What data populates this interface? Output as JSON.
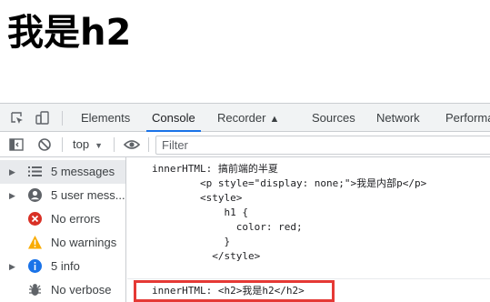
{
  "page": {
    "heading": "我是h2"
  },
  "devtools": {
    "tabs": [
      {
        "label": "Elements"
      },
      {
        "label": "Console"
      },
      {
        "label": "Recorder"
      },
      {
        "label": "Sources"
      },
      {
        "label": "Network"
      },
      {
        "label": "Performa"
      }
    ],
    "active_tab": "Console",
    "recorder_icon": "flask-icon",
    "toolbar": {
      "context": "top",
      "filter_placeholder": "Filter",
      "filter_value": ""
    },
    "sidebar": {
      "items": [
        {
          "label": "5 messages",
          "icon": "list-icon",
          "expandable": true,
          "selected": true
        },
        {
          "label": "5 user mess...",
          "icon": "user-icon",
          "expandable": true
        },
        {
          "label": "No errors",
          "icon": "error-icon",
          "expandable": false
        },
        {
          "label": "No warnings",
          "icon": "warning-icon",
          "expandable": false
        },
        {
          "label": "5 info",
          "icon": "info-icon",
          "expandable": true
        },
        {
          "label": "No verbose",
          "icon": "bug-icon",
          "expandable": false
        }
      ]
    },
    "console": {
      "messages": [
        {
          "text": "innerHTML: 搞前端的半夏\n        <p style=\"display: none;\">我是内部p</p>\n        <style>\n            h1 {\n              color: red;\n            }\n          </style>"
        },
        {
          "text": "innerHTML: <h2>我是h2</h2>"
        }
      ]
    },
    "colors": {
      "accent": "#1a73e8",
      "highlight_border": "#e53935",
      "error": "#d93025",
      "warning": "#f9ab00",
      "info": "#1a73e8"
    }
  }
}
